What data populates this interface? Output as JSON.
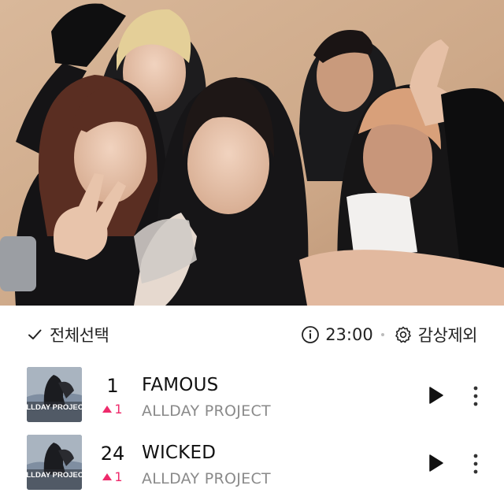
{
  "controls": {
    "select_all_label": "전체선택",
    "duration": "23:00",
    "exclude_label": "감상제외"
  },
  "icons": {
    "select_all": "checkmark-icon",
    "duration": "info-icon",
    "exclude": "gear-icon",
    "play": "play-icon",
    "more": "more-vertical-icon",
    "rank_up": "triangle-up-icon"
  },
  "colors": {
    "rank_up": "#ee2a6b",
    "artist_text": "#8a8a8a"
  },
  "tracks": [
    {
      "rank": "1",
      "change": "1",
      "title": "FAMOUS",
      "artist": "ALLDAY PROJECT",
      "album_art_text": "ALLDAY PROJECT"
    },
    {
      "rank": "24",
      "change": "1",
      "title": "WICKED",
      "artist": "ALLDAY PROJECT",
      "album_art_text": "ALLDAY PROJECT"
    }
  ]
}
